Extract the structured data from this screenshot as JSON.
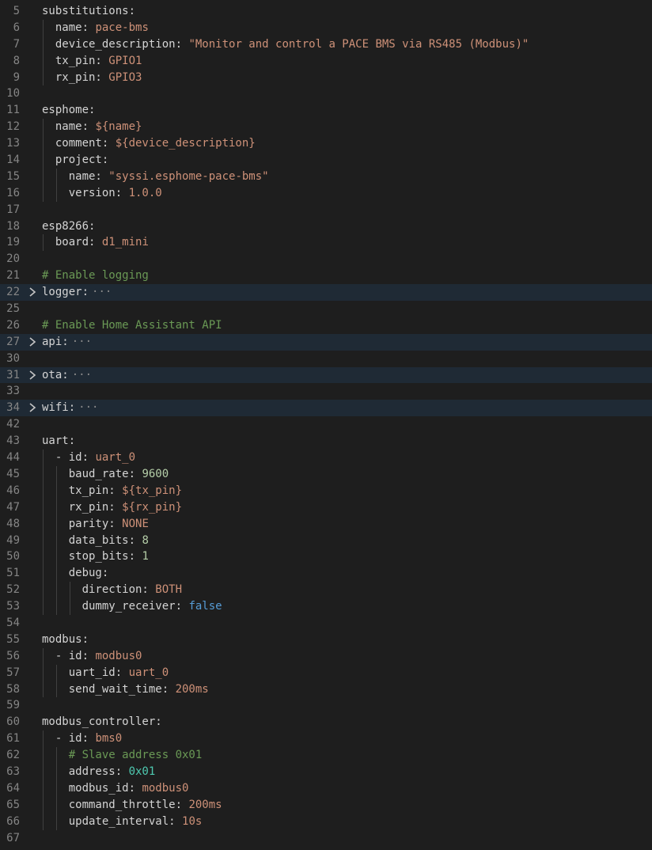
{
  "editor": {
    "language": "yaml",
    "lines": [
      {
        "no": "5",
        "indent": 0,
        "key": "substitutions:",
        "value": "",
        "vt": "k"
      },
      {
        "no": "6",
        "indent": 1,
        "key": "name: ",
        "value": "pace-bms",
        "vt": "s"
      },
      {
        "no": "7",
        "indent": 1,
        "key": "device_description: ",
        "value": "\"Monitor and control a PACE BMS via RS485 (Modbus)\"",
        "vt": "s"
      },
      {
        "no": "8",
        "indent": 1,
        "key": "tx_pin: ",
        "value": "GPIO1",
        "vt": "s"
      },
      {
        "no": "9",
        "indent": 1,
        "key": "rx_pin: ",
        "value": "GPIO3",
        "vt": "s"
      },
      {
        "no": "10",
        "indent": 0,
        "key": "",
        "value": "",
        "vt": "k"
      },
      {
        "no": "11",
        "indent": 0,
        "key": "esphome:",
        "value": "",
        "vt": "k"
      },
      {
        "no": "12",
        "indent": 1,
        "key": "name: ",
        "value": "${name}",
        "vt": "s"
      },
      {
        "no": "13",
        "indent": 1,
        "key": "comment: ",
        "value": "${device_description}",
        "vt": "s"
      },
      {
        "no": "14",
        "indent": 1,
        "key": "project:",
        "value": "",
        "vt": "k"
      },
      {
        "no": "15",
        "indent": 2,
        "key": "name: ",
        "value": "\"syssi.esphome-pace-bms\"",
        "vt": "s"
      },
      {
        "no": "16",
        "indent": 2,
        "key": "version: ",
        "value": "1.0.0",
        "vt": "s"
      },
      {
        "no": "17",
        "indent": 0,
        "key": "",
        "value": "",
        "vt": "k"
      },
      {
        "no": "18",
        "indent": 0,
        "key": "esp8266:",
        "value": "",
        "vt": "k"
      },
      {
        "no": "19",
        "indent": 1,
        "key": "board: ",
        "value": "d1_mini",
        "vt": "s"
      },
      {
        "no": "20",
        "indent": 0,
        "key": "",
        "value": "",
        "vt": "k"
      },
      {
        "no": "21",
        "indent": 0,
        "key": "",
        "value": "# Enable logging",
        "vt": "c"
      },
      {
        "no": "22",
        "indent": 0,
        "key": "logger:",
        "value": "···",
        "vt": "e",
        "folded": true
      },
      {
        "no": "25",
        "indent": 0,
        "key": "",
        "value": "",
        "vt": "k"
      },
      {
        "no": "26",
        "indent": 0,
        "key": "",
        "value": "# Enable Home Assistant API",
        "vt": "c"
      },
      {
        "no": "27",
        "indent": 0,
        "key": "api:",
        "value": "···",
        "vt": "e",
        "folded": true
      },
      {
        "no": "30",
        "indent": 0,
        "key": "",
        "value": "",
        "vt": "k"
      },
      {
        "no": "31",
        "indent": 0,
        "key": "ota:",
        "value": "···",
        "vt": "e",
        "folded": true
      },
      {
        "no": "33",
        "indent": 0,
        "key": "",
        "value": "",
        "vt": "k"
      },
      {
        "no": "34",
        "indent": 0,
        "key": "wifi:",
        "value": "···",
        "vt": "e",
        "folded": true
      },
      {
        "no": "42",
        "indent": 0,
        "key": "",
        "value": "",
        "vt": "k"
      },
      {
        "no": "43",
        "indent": 0,
        "key": "uart:",
        "value": "",
        "vt": "k"
      },
      {
        "no": "44",
        "indent": 1,
        "key": "- id: ",
        "value": "uart_0",
        "vt": "s"
      },
      {
        "no": "45",
        "indent": 2,
        "key": "baud_rate: ",
        "value": "9600",
        "vt": "n"
      },
      {
        "no": "46",
        "indent": 2,
        "key": "tx_pin: ",
        "value": "${tx_pin}",
        "vt": "s"
      },
      {
        "no": "47",
        "indent": 2,
        "key": "rx_pin: ",
        "value": "${rx_pin}",
        "vt": "s"
      },
      {
        "no": "48",
        "indent": 2,
        "key": "parity: ",
        "value": "NONE",
        "vt": "s"
      },
      {
        "no": "49",
        "indent": 2,
        "key": "data_bits: ",
        "value": "8",
        "vt": "n"
      },
      {
        "no": "50",
        "indent": 2,
        "key": "stop_bits: ",
        "value": "1",
        "vt": "n"
      },
      {
        "no": "51",
        "indent": 2,
        "key": "debug:",
        "value": "",
        "vt": "k"
      },
      {
        "no": "52",
        "indent": 3,
        "key": "direction: ",
        "value": "BOTH",
        "vt": "s"
      },
      {
        "no": "53",
        "indent": 3,
        "key": "dummy_receiver: ",
        "value": "false",
        "vt": "b"
      },
      {
        "no": "54",
        "indent": 0,
        "key": "",
        "value": "",
        "vt": "k"
      },
      {
        "no": "55",
        "indent": 0,
        "key": "modbus:",
        "value": "",
        "vt": "k"
      },
      {
        "no": "56",
        "indent": 1,
        "key": "- id: ",
        "value": "modbus0",
        "vt": "s"
      },
      {
        "no": "57",
        "indent": 2,
        "key": "uart_id: ",
        "value": "uart_0",
        "vt": "s"
      },
      {
        "no": "58",
        "indent": 2,
        "key": "send_wait_time: ",
        "value": "200ms",
        "vt": "s"
      },
      {
        "no": "59",
        "indent": 0,
        "key": "",
        "value": "",
        "vt": "k"
      },
      {
        "no": "60",
        "indent": 0,
        "key": "modbus_controller:",
        "value": "",
        "vt": "k"
      },
      {
        "no": "61",
        "indent": 1,
        "key": "- id: ",
        "value": "bms0",
        "vt": "s"
      },
      {
        "no": "62",
        "indent": 2,
        "key": "",
        "value": "# Slave address 0x01",
        "vt": "c"
      },
      {
        "no": "63",
        "indent": 2,
        "key": "address: ",
        "value": "0x01",
        "vt": "h"
      },
      {
        "no": "64",
        "indent": 2,
        "key": "modbus_id: ",
        "value": "modbus0",
        "vt": "s"
      },
      {
        "no": "65",
        "indent": 2,
        "key": "command_throttle: ",
        "value": "200ms",
        "vt": "s"
      },
      {
        "no": "66",
        "indent": 2,
        "key": "update_interval: ",
        "value": "10s",
        "vt": "s"
      },
      {
        "no": "67",
        "indent": 0,
        "key": "",
        "value": "",
        "vt": "k"
      }
    ]
  },
  "colors": {
    "background": "#1e1e1e",
    "folded_line_bg": "#1f2a35",
    "line_number": "#858585",
    "key": "#d4d4d4",
    "string": "#ce9178",
    "number": "#b5cea8",
    "hex": "#4ec9b0",
    "boolean": "#569cd6",
    "comment": "#6a9955"
  },
  "icons": {
    "fold": "chevron-right-icon"
  }
}
